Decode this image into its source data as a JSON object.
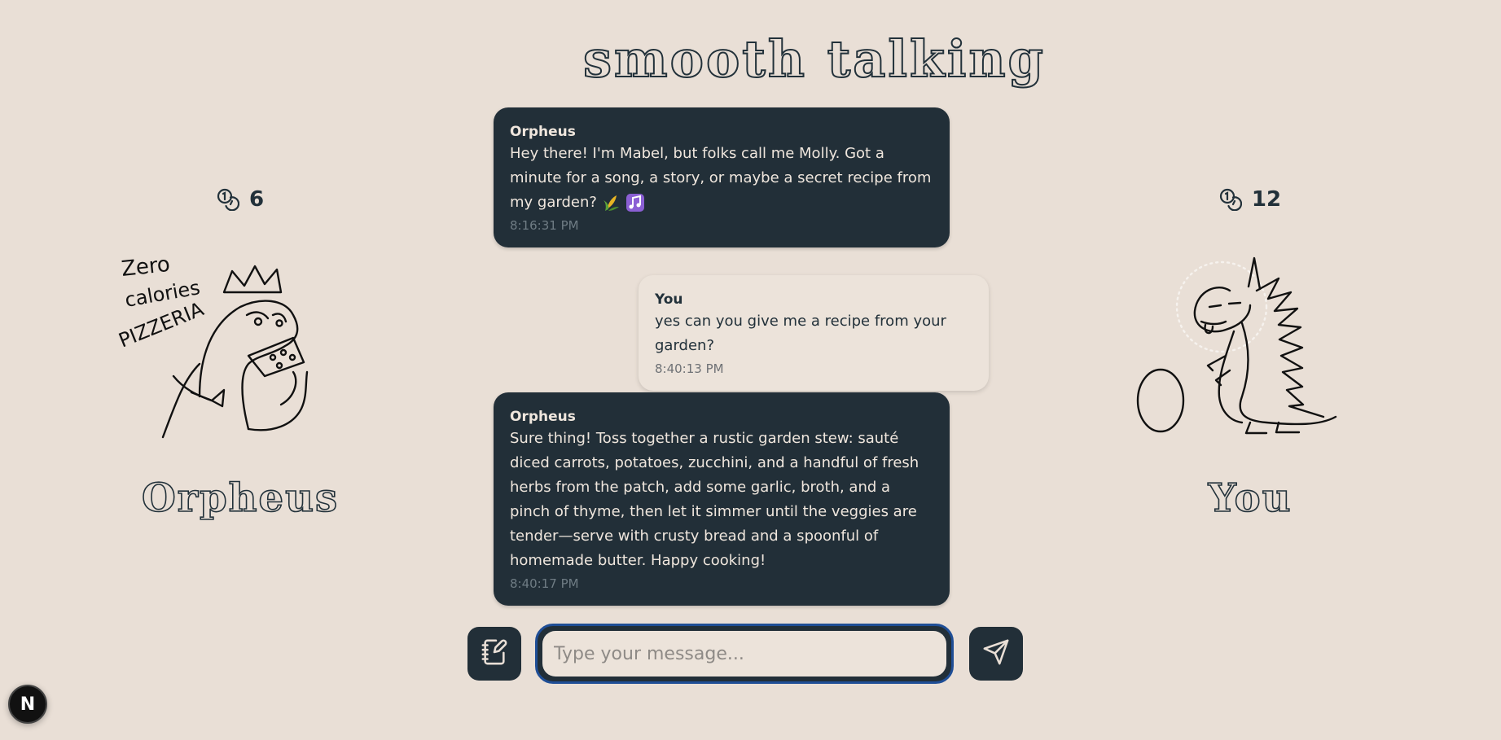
{
  "app": {
    "title": "smooth talking"
  },
  "left_player": {
    "name": "Orpheus",
    "coins": "6",
    "coin_icon": "coins-icon",
    "avatar": "pizzeria-dinosaur-doodle",
    "avatar_text": [
      "Zero",
      "calories",
      "PIZZERIA"
    ]
  },
  "right_player": {
    "name": "You",
    "coins": "12",
    "coin_icon": "coins-icon",
    "avatar": "spiky-dinosaur-doodle"
  },
  "messages": [
    {
      "sender": "Orpheus",
      "role": "bot",
      "text": "Hey there! I'm Mabel, but folks call me Molly. Got a minute for a song, a story, or maybe a secret recipe from my garden?",
      "emojis": [
        "corn-emoji",
        "music-emoji"
      ],
      "time": "8:16:31 PM"
    },
    {
      "sender": "You",
      "role": "user",
      "text": "yes can you give me a recipe from your garden?",
      "time": "8:40:13 PM"
    },
    {
      "sender": "Orpheus",
      "role": "bot",
      "text": "Sure thing! Toss together a rustic garden stew: sauté diced carrots, potatoes, zucchini, and a handful of fresh herbs from the patch, add some garlic, broth, and a pinch of thyme, then let it simmer until the veggies are tender—serve with crusty bread and a spoonful of homemade butter. Happy cooking!",
      "time": "8:40:17 PM"
    }
  ],
  "composer": {
    "placeholder": "Type your message...",
    "value": "",
    "notes_icon": "notebook-pen-icon",
    "send_icon": "send-icon"
  },
  "badge": {
    "letter": "N"
  },
  "colors": {
    "background": "#e9dfd6",
    "dark": "#222f38",
    "user_bubble": "#ece3da",
    "focus_ring": "#1f4e96"
  }
}
